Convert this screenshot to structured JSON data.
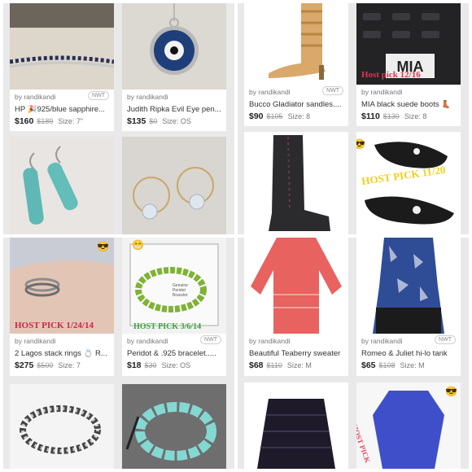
{
  "cards": [
    {
      "seller": "by randikandi",
      "nwt": "NWT",
      "title": "HP 🎉925/blue sapphire...",
      "price": "$160",
      "orig": "$189",
      "size": "Size: 7\""
    },
    {
      "seller": "by randikandi",
      "title": "Judith Ripka Evil Eye pen...",
      "price": "$135",
      "orig": "$0",
      "size": "Size: OS"
    },
    {
      "seller": "by randikandi",
      "nwt": "NWT",
      "title": "Bucco Gladiator sandles....",
      "price": "$90",
      "orig": "$105",
      "size": "Size: 8"
    },
    {
      "seller": "by randikandi",
      "title": "MIA black suede boots 👢",
      "price": "$110",
      "orig": "$130",
      "size": "Size: 8"
    },
    {
      "seller": "by randikandi",
      "title": "2 Lagos stack rings 💍 R...",
      "price": "$275",
      "orig": "$500",
      "size": "Size: 7"
    },
    {
      "seller": "by randikandi",
      "nwt": "NWT",
      "title": "Peridot & .925 bracelet.....",
      "price": "$18",
      "orig": "$30",
      "size": "Size: OS"
    },
    {
      "seller": "by randikandi",
      "title": "Beautiful Teaberry sweater",
      "price": "$68",
      "orig": "$110",
      "size": "Size: M"
    },
    {
      "seller": "by randikandi",
      "nwt": "NWT",
      "title": "Romeo & Juliet hi-lo tank",
      "price": "$65",
      "orig": "$108",
      "size": "Size: M"
    }
  ],
  "overlays": {
    "host_pick_boots": "Host pick 12/16",
    "host_pick_shoes": "HOST PICK 11/20",
    "host_pick_rings": "HOST PICK 1/24/14",
    "host_pick_bracelet": "HOST PICK 3/6/14",
    "host_pick_top": "HOST PICK",
    "box_label": "Genuine Peridot Bracelet",
    "boots_brand": "MIA"
  },
  "emojis": {
    "sunglasses": "😎",
    "smile": "😁"
  }
}
